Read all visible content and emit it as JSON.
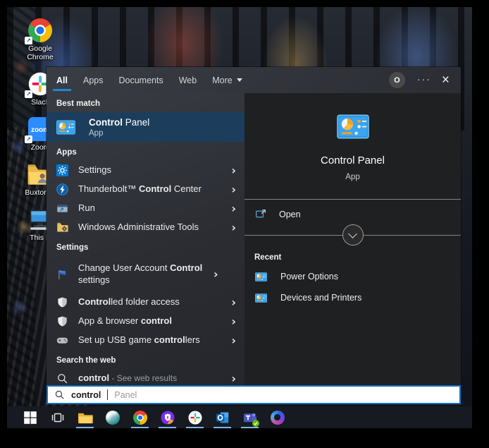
{
  "colors": {
    "accent_blue": "#1a8ad1",
    "highlight_row": "#1c3e5c",
    "taskbar_underline": "#7ab7e8",
    "search_border": "#1273c4"
  },
  "tabs": {
    "items": [
      {
        "label": "All",
        "active": true
      },
      {
        "label": "Apps",
        "active": false
      },
      {
        "label": "Documents",
        "active": false
      },
      {
        "label": "Web",
        "active": false
      },
      {
        "label": "More",
        "active": false,
        "dropdown": true
      }
    ]
  },
  "topbar": {
    "avatar_letter": "O",
    "ellipsis": "···",
    "close": "×"
  },
  "left": {
    "best_match": {
      "header": "Best match",
      "name": "result-control-panel-best-match",
      "icon": "control-panel",
      "title": [
        {
          "t": "Control",
          "b": true
        },
        {
          "t": " Panel",
          "b": false
        }
      ],
      "subtitle": "App"
    },
    "sections": [
      {
        "header": "Apps",
        "items": [
          {
            "name": "result-settings",
            "icon": "settings-gear",
            "label": [
              {
                "t": "Settings",
                "b": false
              }
            ]
          },
          {
            "name": "result-thunderbolt-control-center",
            "icon": "thunderbolt",
            "label": [
              {
                "t": "Thunderbolt™ ",
                "b": false
              },
              {
                "t": "Control",
                "b": true
              },
              {
                "t": " Center",
                "b": false
              }
            ]
          },
          {
            "name": "result-run",
            "icon": "run-window",
            "label": [
              {
                "t": "Run",
                "b": false
              }
            ]
          },
          {
            "name": "result-windows-administrative-tools",
            "icon": "admin-tools-folder",
            "label": [
              {
                "t": "Windows Administrative Tools",
                "b": false
              }
            ]
          }
        ]
      },
      {
        "header": "Settings",
        "items": [
          {
            "name": "result-change-uac-settings",
            "icon": "uac-flag",
            "twoline": true,
            "label": [
              {
                "t": "Change User Account ",
                "b": false
              },
              {
                "t": "Control",
                "b": true
              },
              {
                "t": " settings",
                "b": false
              }
            ]
          },
          {
            "name": "result-controlled-folder-access",
            "icon": "defender-shield",
            "label": [
              {
                "t": "Control",
                "b": true
              },
              {
                "t": "led folder access",
                "b": false
              }
            ]
          },
          {
            "name": "result-app-browser-control",
            "icon": "defender-shield",
            "label": [
              {
                "t": "App & browser ",
                "b": false
              },
              {
                "t": "control",
                "b": true
              }
            ]
          },
          {
            "name": "result-usb-game-controllers",
            "icon": "gamepad",
            "label": [
              {
                "t": "Set up USB game ",
                "b": false
              },
              {
                "t": "control",
                "b": true
              },
              {
                "t": "lers",
                "b": false
              }
            ]
          }
        ]
      },
      {
        "header": "Search the web",
        "items": [
          {
            "name": "result-control-web-search",
            "icon": "search-magnifier",
            "label": [
              {
                "t": "control",
                "b": true
              },
              {
                "t": " - See web results",
                "b": false,
                "dim": true
              }
            ]
          }
        ]
      }
    ]
  },
  "preview": {
    "icon": "control-panel",
    "title": "Control Panel",
    "subtitle": "App",
    "open_label": "Open",
    "recent_header": "Recent",
    "recent": [
      {
        "name": "recent-power-options",
        "icon": "control-panel",
        "label": "Power Options"
      },
      {
        "name": "recent-devices-and-printers",
        "icon": "control-panel",
        "label": "Devices and Printers"
      }
    ]
  },
  "search_box": {
    "typed": "control",
    "ghost": "Panel"
  },
  "desktop_icons": [
    {
      "name": "desktop-icon-google-chrome",
      "icon": "chrome",
      "label": "Google Chrome",
      "shortcut": true
    },
    {
      "name": "desktop-icon-slack",
      "icon": "slack",
      "label": "Slack",
      "shortcut": true
    },
    {
      "name": "desktop-icon-zoom",
      "icon": "zoom",
      "label": "Zoom",
      "shortcut": true
    },
    {
      "name": "desktop-icon-buxton-folder",
      "icon": "user-folder",
      "label": "Buxton C",
      "shortcut": false
    },
    {
      "name": "desktop-icon-this-pc",
      "icon": "this-pc",
      "label": "This P",
      "shortcut": false
    }
  ],
  "taskbar": [
    {
      "name": "taskbar-start",
      "icon": "windows-logo",
      "active": false
    },
    {
      "name": "taskbar-task-view",
      "icon": "task-view",
      "active": false
    },
    {
      "name": "taskbar-file-explorer",
      "icon": "file-explorer",
      "active": true
    },
    {
      "name": "taskbar-app-green-sphere",
      "icon": "green-sphere-app",
      "active": false
    },
    {
      "name": "taskbar-chrome",
      "icon": "chrome",
      "active": true
    },
    {
      "name": "taskbar-security-app",
      "icon": "security-shield-app",
      "active": true
    },
    {
      "name": "taskbar-slack",
      "icon": "slack",
      "active": true
    },
    {
      "name": "taskbar-outlook",
      "icon": "outlook",
      "active": true
    },
    {
      "name": "taskbar-teams",
      "icon": "teams",
      "active": true,
      "badge": "available"
    },
    {
      "name": "taskbar-copilot",
      "icon": "copilot",
      "active": false
    }
  ]
}
